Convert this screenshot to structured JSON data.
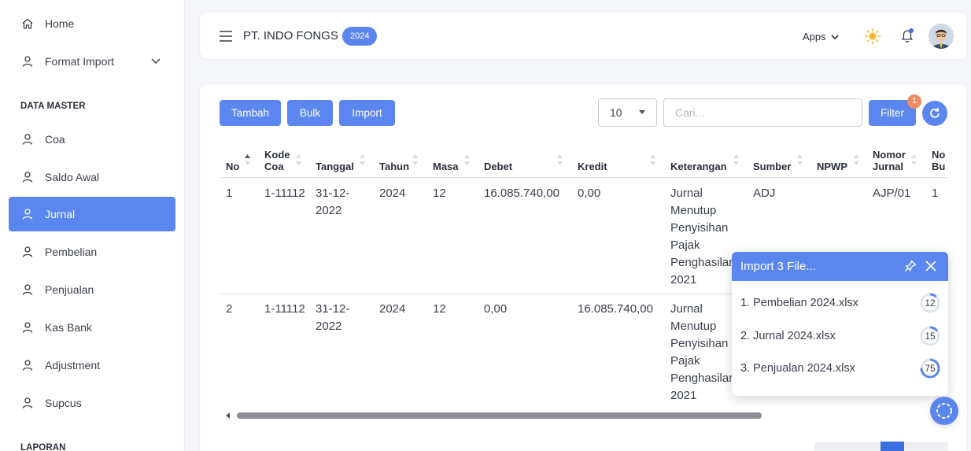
{
  "sidebar": {
    "items": [
      {
        "label": "Home",
        "icon": "home-icon"
      },
      {
        "label": "Format Import",
        "icon": "user-icon"
      }
    ],
    "section_master": "DATA MASTER",
    "master_items": [
      {
        "label": "Coa"
      },
      {
        "label": "Saldo Awal"
      },
      {
        "label": "Jurnal",
        "active": true
      },
      {
        "label": "Pembelian"
      },
      {
        "label": "Penjualan"
      },
      {
        "label": "Kas Bank"
      },
      {
        "label": "Adjustment"
      },
      {
        "label": "Supcus"
      }
    ],
    "section_laporan": "LAPORAN"
  },
  "header": {
    "company": "PT. INDO FONGS",
    "year": "2024",
    "apps_label": "Apps"
  },
  "toolbar": {
    "tambah": "Tambah",
    "bulk": "Bulk",
    "import": "Import",
    "page_size": "10",
    "search_placeholder": "Cari...",
    "filter": "Filter",
    "filter_badge": "1"
  },
  "table": {
    "columns": {
      "no": "No",
      "kode_coa": "Kode Coa",
      "tanggal": "Tanggal",
      "tahun": "Tahun",
      "masa": "Masa",
      "debet": "Debet",
      "kredit": "Kredit",
      "keterangan": "Keterangan",
      "sumber": "Sumber",
      "npwp": "NPWP",
      "nomor_jurnal": "Nomor Jurnal",
      "no_bukti": "No Bu"
    },
    "rows": [
      {
        "no": "1",
        "kode_coa": "1-11112",
        "tanggal": "31-12-2022",
        "tahun": "2024",
        "masa": "12",
        "debet": "16.085.740,00",
        "kredit": "0,00",
        "keterangan": "Jurnal Menutup Penyisihan Pajak Penghasilan 2021",
        "sumber": "ADJ",
        "npwp": "",
        "nomor_jurnal": "AJP/01",
        "no_bukti": "1"
      },
      {
        "no": "2",
        "kode_coa": "1-11112",
        "tanggal": "31-12-2022",
        "tahun": "2024",
        "masa": "12",
        "debet": "0,00",
        "kredit": "16.085.740,00",
        "keterangan": "Jurnal Menutup Penyisihan Pajak Penghasilan 2021",
        "sumber": "",
        "npwp": "",
        "nomor_jurnal": "",
        "no_bukti": ""
      }
    ]
  },
  "import_popup": {
    "title": "Import 3 File...",
    "files": [
      {
        "name": "1. Pembelian 2024.xlsx",
        "progress": 12
      },
      {
        "name": "2. Jurnal 2024.xlsx",
        "progress": 15
      },
      {
        "name": "3. Penjualan 2024.xlsx",
        "progress": 75
      }
    ]
  },
  "colors": {
    "accent": "#5b86f0",
    "badge": "#f08b63"
  }
}
